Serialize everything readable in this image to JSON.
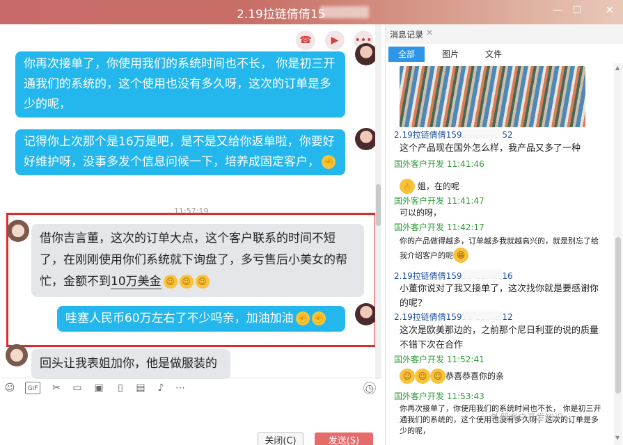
{
  "window": {
    "title": "2.19拉链倩倩15",
    "controls": [
      "minimize-icon",
      "maximize-icon",
      "close-icon"
    ]
  },
  "chat": {
    "messages": [
      {
        "side": "right",
        "color": "blue",
        "text": "你再次接单了，你使用我们的系统时间也不长， 你是初三开通我们的系统的，这个使用也没有多久呀，这次的订单是多少的呢，"
      },
      {
        "side": "right",
        "color": "blue",
        "text": "记得你上次那个是16万是吧，是不是又给你返单啦，你要好好维护呀，没事多发个信息问候一下，培养成固定客户，"
      },
      {
        "side": "left",
        "color": "gray",
        "text_before": "借你吉言董，这次的订单大点，这个客户联系的时间不短了，在刚刚使用你们系统就下询盘了，多亏售后小美女的帮忙，金额不到",
        "text_underlined": "10万美金"
      },
      {
        "side": "right",
        "color": "blue",
        "text": "哇塞人民币60万左右了不少吗亲，加油加油"
      },
      {
        "side": "left",
        "color": "gray",
        "text": "回头让我表姐加你，他是做服装的"
      }
    ],
    "timestamp": "11:57:19",
    "buttons": {
      "close": "关闭(C)",
      "send": "发送(S)"
    }
  },
  "history": {
    "title": "消息记录",
    "tabs": [
      "全部",
      "图片",
      "文件"
    ],
    "entries": [
      {
        "sender": "2.19拉链倩倩159",
        "time": "22 11:40:52",
        "color": "blue",
        "text": "这个产品现在国外怎么样，我产品又多了一种"
      },
      {
        "sender": "国外客户开发",
        "time": "11:41:46",
        "color": "green",
        "text": "姐，在的呢"
      },
      {
        "sender": "国外客户开发",
        "time": "11:41:47",
        "color": "green",
        "text": "可以的呀，"
      },
      {
        "sender": "国外客户开发",
        "time": "11:42:17",
        "color": "green",
        "text": "你的产品做得越多，订单越多我就越高兴的，就是别忘了给我介绍客户的呢"
      },
      {
        "sender": "2.19拉链倩倩159",
        "time": "12 11:43:16",
        "color": "blue",
        "text": "小董你说对了我又接单了，这次找你就是要感谢你的呢？"
      },
      {
        "sender": "2.19拉链倩倩159",
        "time": "22 11:48:12",
        "color": "blue",
        "text": "这次是欧美那边的，之前那个尼日利亚的说的质量不错下次在合作"
      },
      {
        "sender": "国外客户开发",
        "time": "11:52:41",
        "color": "green",
        "text": "恭喜恭喜你的亲"
      },
      {
        "sender": "国外客户开发",
        "time": "11:53:43",
        "color": "green",
        "text": "你再次接单了，你使用我们的系统时间也不长， 你是初三开通我们的系统的，这个使用也没有多久呀，这次的订单是多少的呢，"
      }
    ]
  },
  "watermark": "外贸客户开发知识",
  "colors": {
    "accent_blue": "#23b7ee",
    "send_red": "#e66b6b",
    "highlight_red": "#e02b2b",
    "tab_blue": "#2e95e8"
  }
}
